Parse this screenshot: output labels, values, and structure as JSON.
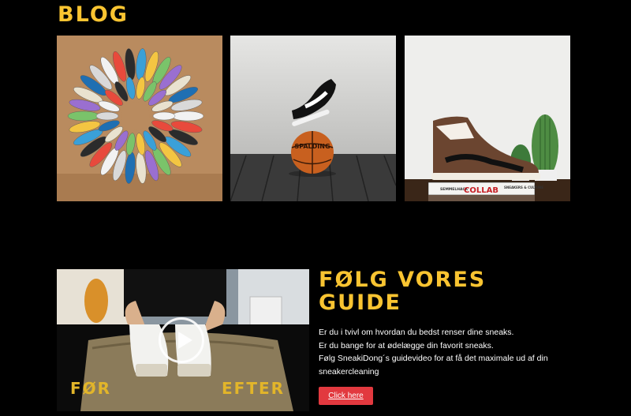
{
  "blog": {
    "title": "BLOG"
  },
  "tiles": {
    "collab_book": {
      "brand": "SEMMELHACK",
      "title": "COLLAB",
      "subtitle": "SNEAKERS & CULTURE"
    },
    "ball": {
      "brand": "SPALDING"
    }
  },
  "guide": {
    "title_line1": "FØLG VORES",
    "title_line2": "GUIDE",
    "lines": [
      "Er du i tvivl om hvordan du bedst renser dine sneaks.",
      "Er du bange for at ødelægge din favorit sneaks.",
      "Følg SneakiDong´s guidevideo for at få det maximale ud af din sneakercleaning"
    ],
    "button_label": "Click here"
  },
  "video": {
    "label_before": "FØR",
    "label_after": "EFTER"
  },
  "colors": {
    "accent": "#f9c431",
    "button": "#e2393f",
    "background": "#000000"
  }
}
